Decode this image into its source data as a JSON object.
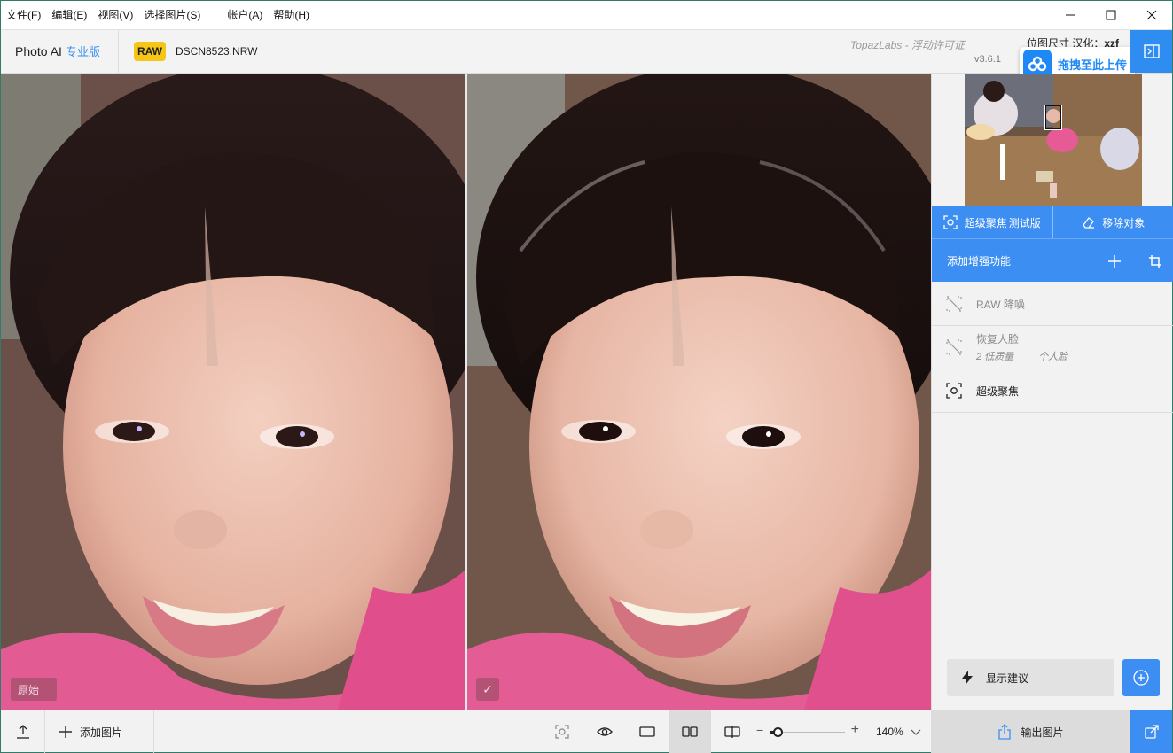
{
  "menu": [
    "文件(F)",
    "编辑(E)",
    "视图(V)",
    "选择图片(S)",
    "帐户(A)",
    "帮助(H)"
  ],
  "header": {
    "app_name": "Photo AI",
    "edition": "专业版",
    "file_type_badge": "RAW",
    "filename": "DSCN8523.NRW",
    "license_text": "TopazLabs - 浮动许可证",
    "version": "v3.6.1",
    "localize_label": "位图尺寸 汉化：",
    "localize_author": "xzf",
    "upload_badge": "拖拽至此上传"
  },
  "viewer": {
    "left_label": "原始",
    "right_check": "✓"
  },
  "panel": {
    "modes": [
      {
        "label": "超级聚焦",
        "tag": "测试版",
        "icon": "focus-icon"
      },
      {
        "label": "移除对象",
        "tag": "",
        "icon": "eraser-icon"
      }
    ],
    "add_enhancement": "添加增强功能",
    "features": [
      {
        "label": "RAW 降噪",
        "sub": [],
        "enabled": false
      },
      {
        "label": "恢复人脸",
        "sub": [
          "2 低质量",
          "个人脸"
        ],
        "enabled": false
      },
      {
        "label": "超级聚焦",
        "sub": [],
        "enabled": true
      }
    ],
    "suggest_button": "显示建议"
  },
  "bottom": {
    "add_image": "添加图片",
    "zoom_value": "140%",
    "zoom_level": 0.1,
    "export_button": "输出图片"
  },
  "colors": {
    "accent": "#3d8ef2",
    "raw_badge": "#f5c518",
    "upload_blue": "#1e88f7"
  }
}
